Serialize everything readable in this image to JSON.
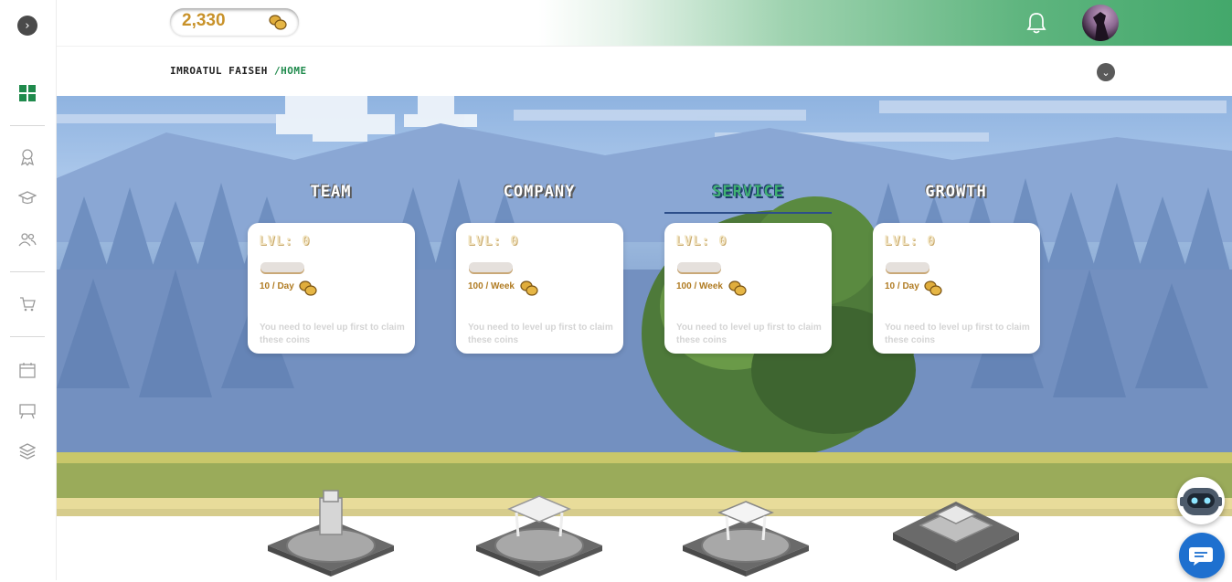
{
  "header": {
    "coin_balance": "2,330",
    "coin_icon": "coins-icon",
    "notification_icon": "bell-icon",
    "avatar_icon": "user-avatar"
  },
  "breadcrumb": {
    "user": "Imroatul Faiseh",
    "separator": " /",
    "current": "Home"
  },
  "sidebar": {
    "items": [
      {
        "icon": "chevron-right-icon"
      },
      {
        "icon": "dashboard-grid-icon",
        "active": true
      },
      {
        "icon": "award-icon"
      },
      {
        "icon": "graduation-cap-icon"
      },
      {
        "icon": "users-icon"
      },
      {
        "icon": "cart-icon"
      },
      {
        "icon": "calendar-icon"
      },
      {
        "icon": "presentation-board-icon"
      },
      {
        "icon": "layers-icon"
      }
    ]
  },
  "tabs": [
    {
      "label": "Team",
      "active": false
    },
    {
      "label": "Company",
      "active": false
    },
    {
      "label": "Service",
      "active": true
    },
    {
      "label": "Growth",
      "active": false
    }
  ],
  "cards": [
    {
      "level": "LVL: 0",
      "rate": "10 / Day",
      "message": "You need to level up first to claim these coins"
    },
    {
      "level": "LVL: 0",
      "rate": "100 / Week",
      "message": "You need to level up first to claim these coins"
    },
    {
      "level": "LVL: 0",
      "rate": "100 / Week",
      "message": "You need to level up first to claim these coins"
    },
    {
      "level": "LVL: 0",
      "rate": "10 / Day",
      "message": "You need to level up first to claim these coins"
    }
  ],
  "colors": {
    "accent_green": "#1f8a4c",
    "coin_gold": "#c8922a",
    "chat_blue": "#1e70cf"
  }
}
